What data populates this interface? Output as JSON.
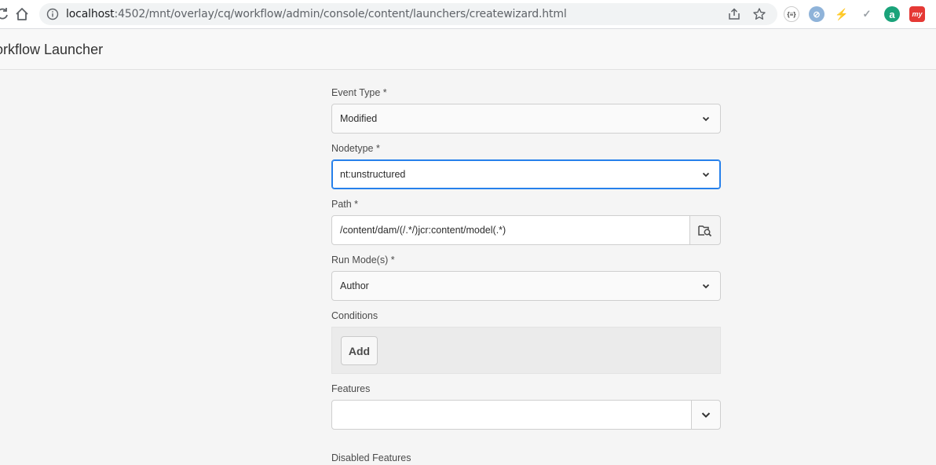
{
  "browser": {
    "url_host": "localhost",
    "url_path": ":4502/mnt/overlay/cq/workflow/admin/console/content/launchers/createwizard.html",
    "extensions": [
      {
        "name": "json-formatter-icon",
        "glyph": "{≡}"
      },
      {
        "name": "extension-globe-icon",
        "glyph": "⊘"
      },
      {
        "name": "extension-bolt-icon",
        "glyph": "⚡"
      },
      {
        "name": "extension-feather-icon",
        "glyph": "✓"
      },
      {
        "name": "extension-a-icon",
        "glyph": "a"
      },
      {
        "name": "extension-red-icon",
        "glyph": "my"
      }
    ]
  },
  "header": {
    "title": "orkflow Launcher"
  },
  "form": {
    "event_type": {
      "label": "Event Type *",
      "value": "Modified"
    },
    "nodetype": {
      "label": "Nodetype *",
      "value": "nt:unstructured"
    },
    "path": {
      "label": "Path *",
      "value": "/content/dam/(/.*/)jcr:content/model(.*)"
    },
    "run_modes": {
      "label": "Run Mode(s) *",
      "value": "Author"
    },
    "conditions": {
      "label": "Conditions",
      "add_label": "Add"
    },
    "features": {
      "label": "Features",
      "value": ""
    },
    "disabled_features": {
      "label": "Disabled Features"
    }
  },
  "colors": {
    "focus": "#2680eb",
    "background": "#f5f5f5"
  }
}
